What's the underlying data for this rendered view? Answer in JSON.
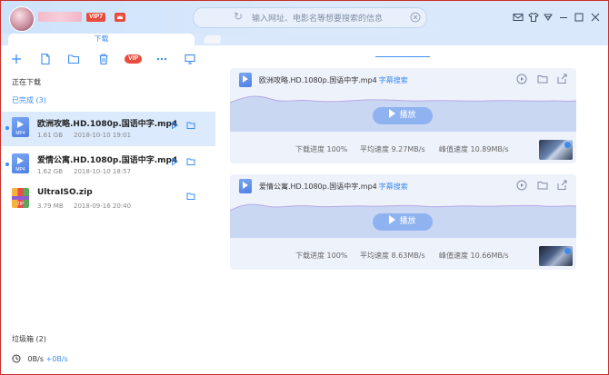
{
  "titlebar": {
    "vip_label": "VIP7",
    "search_placeholder": "输入网址、电影名等想要搜索的信息"
  },
  "tabs": {
    "active_label": "下载"
  },
  "toolbar": {
    "vip_label": "VIP"
  },
  "sections": {
    "downloading": "正在下载",
    "completed": "已完成 (3)",
    "trash": "垃圾箱 (2)"
  },
  "files": [
    {
      "name": "欧洲攻略.HD.1080p.国语中字.mp4",
      "size": "1.61 GB",
      "date": "2018-10-10 19:01",
      "ext": "MP4"
    },
    {
      "name": "爱情公寓.HD.1080p.国语中字.mp4",
      "size": "1.62 GB",
      "date": "2018-10-10 18:57",
      "ext": "MP4"
    },
    {
      "name": "UltraISO.zip",
      "size": "3.79 MB",
      "date": "2018-09-16 20:40",
      "ext": "ZIP"
    }
  ],
  "speed": {
    "down": "0B/s",
    "up": "+0B/s"
  },
  "cards": [
    {
      "title": "欧洲攻略.HD.1080p.国语中字.mp4",
      "subtitle_link": "字幕搜索",
      "play_label": "播放",
      "progress_text": "下载进度 100%",
      "avg_speed": "平均速度 9.27MB/s",
      "peak_speed": "峰值速度 10.89MB/s",
      "progress": 1.0
    },
    {
      "title": "爱情公寓.HD.1080p.国语中字.mp4",
      "subtitle_link": "字幕搜索",
      "play_label": "播放",
      "progress_text": "下载进度 100%",
      "avg_speed": "平均速度 8.63MB/s",
      "peak_speed": "峰值速度 10.66MB/s",
      "progress": 1.0
    }
  ],
  "colors": {
    "accent": "#3c8cf0",
    "vip": "#e94b3c",
    "window_border": "#c9302c"
  }
}
